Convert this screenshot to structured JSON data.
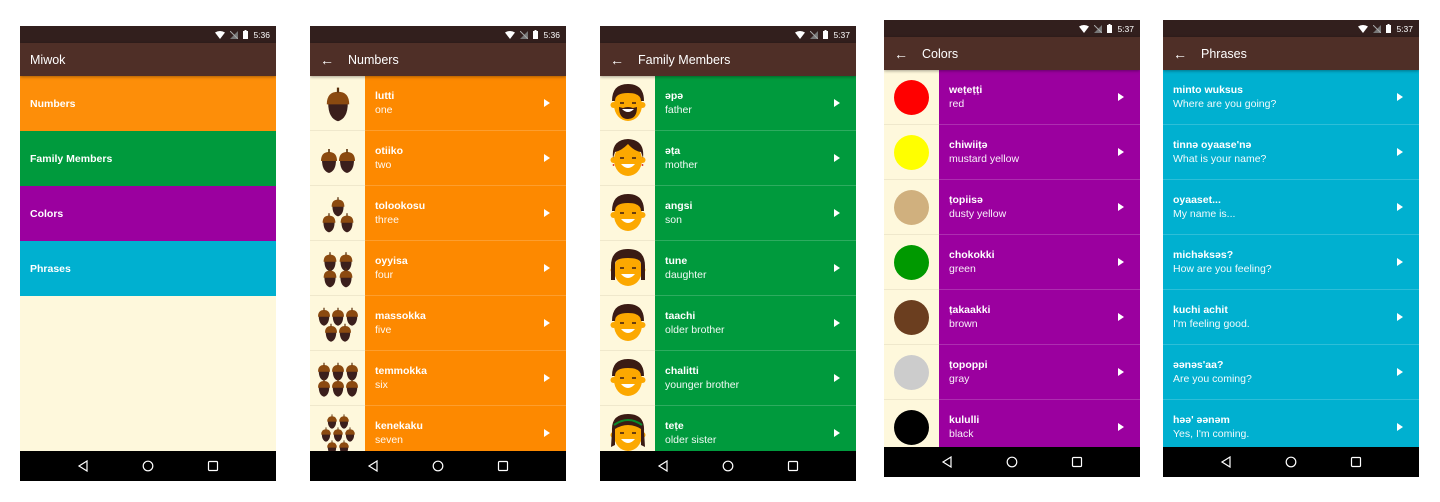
{
  "colors": {
    "statusbar": "#321f1d",
    "toolbar": "#4f2f27",
    "background": "#fef8dc",
    "numbers": "#fd8e09",
    "family": "#379237",
    "colors_cat": "#8800a0",
    "phrases": "#16aad0"
  },
  "screens": [
    {
      "time": "5:36",
      "title": "Miwok",
      "categories": [
        {
          "label": "Numbers",
          "color": "#fd8e09"
        },
        {
          "label": "Family Members",
          "color": "#009a3d"
        },
        {
          "label": "Colors",
          "color": "#9b009f"
        },
        {
          "label": "Phrases",
          "color": "#00b0d0"
        }
      ]
    },
    {
      "time": "5:36",
      "title": "Numbers",
      "color": "#fd8900",
      "items": [
        {
          "miwok": "lutti",
          "english": "one",
          "icon": "acorn-icon",
          "count": 1
        },
        {
          "miwok": "otiiko",
          "english": "two",
          "icon": "acorn-icon",
          "count": 2
        },
        {
          "miwok": "tolookosu",
          "english": "three",
          "icon": "acorn-icon",
          "count": 3
        },
        {
          "miwok": "oyyisa",
          "english": "four",
          "icon": "acorn-icon",
          "count": 4
        },
        {
          "miwok": "massokka",
          "english": "five",
          "icon": "acorn-icon",
          "count": 5
        },
        {
          "miwok": "temmokka",
          "english": "six",
          "icon": "acorn-icon",
          "count": 6
        },
        {
          "miwok": "kenekaku",
          "english": "seven",
          "icon": "acorn-icon",
          "count": 7
        }
      ]
    },
    {
      "time": "5:37",
      "title": "Family Members",
      "color": "#009a3d",
      "items": [
        {
          "miwok": "əpə",
          "english": "father",
          "icon": "father-face-icon"
        },
        {
          "miwok": "əṭa",
          "english": "mother",
          "icon": "mother-face-icon"
        },
        {
          "miwok": "angsi",
          "english": "son",
          "icon": "son-face-icon"
        },
        {
          "miwok": "tune",
          "english": "daughter",
          "icon": "daughter-face-icon"
        },
        {
          "miwok": "taachi",
          "english": "older brother",
          "icon": "older-brother-face-icon"
        },
        {
          "miwok": "chalitti",
          "english": "younger brother",
          "icon": "younger-brother-face-icon"
        },
        {
          "miwok": "teṭe",
          "english": "older sister",
          "icon": "older-sister-face-icon"
        }
      ]
    },
    {
      "time": "5:37",
      "title": "Colors",
      "color": "#9b009f",
      "items": [
        {
          "miwok": "weṭeṭṭi",
          "english": "red",
          "swatch": "#ff0000"
        },
        {
          "miwok": "chiwiiṭə",
          "english": "mustard yellow",
          "swatch": "#ffff00"
        },
        {
          "miwok": "ṭopiisə",
          "english": "dusty yellow",
          "swatch": "#d0b07e"
        },
        {
          "miwok": "chokokki",
          "english": "green",
          "swatch": "#009900"
        },
        {
          "miwok": "ṭakaakki",
          "english": "brown",
          "swatch": "#6b3e1f"
        },
        {
          "miwok": "ṭopoppi",
          "english": "gray",
          "swatch": "#cccccc"
        },
        {
          "miwok": "kululli",
          "english": "black",
          "swatch": "#000000"
        }
      ]
    },
    {
      "time": "5:37",
      "title": "Phrases",
      "color": "#00b0d0",
      "items": [
        {
          "miwok": "minto wuksus",
          "english": "Where are you going?"
        },
        {
          "miwok": "tinnə oyaase'nə",
          "english": "What is your name?"
        },
        {
          "miwok": "oyaaset...",
          "english": "My name is..."
        },
        {
          "miwok": "michəksəs?",
          "english": "How are you feeling?"
        },
        {
          "miwok": "kuchi achit",
          "english": "I'm feeling good."
        },
        {
          "miwok": "əənəs'aa?",
          "english": "Are you coming?"
        },
        {
          "miwok": "həə' əənəm",
          "english": "Yes, I'm coming."
        }
      ]
    }
  ]
}
